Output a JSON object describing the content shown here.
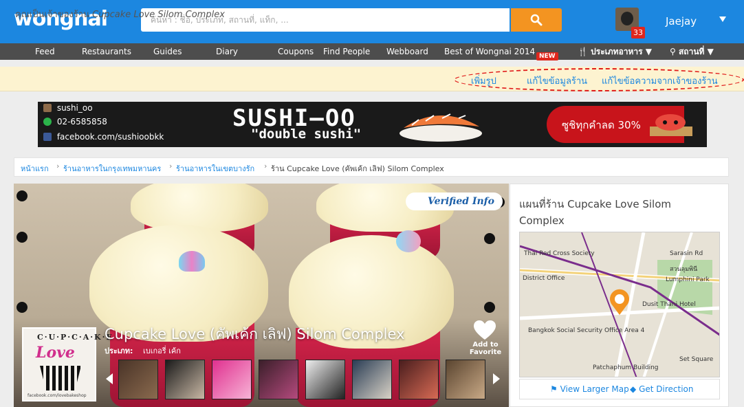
{
  "header": {
    "logo_text": "wongnai",
    "search_placeholder": "ค้นหา : ชื่อ, ประเภท, สถานที่, แท็ก, ...",
    "notification_count": "33",
    "username": "Jaejay"
  },
  "nav": {
    "items": [
      "Feed",
      "Restaurants",
      "Guides",
      "Diary",
      "Coupons",
      "Find People",
      "Webboard",
      "Best of Wongnai 2014"
    ],
    "new_badge": "NEW",
    "food_type": "ประเภทอาหาร",
    "location": "สถานที่"
  },
  "owner_bar": {
    "prefix": "คุณเป็นเจ้าของร้าน",
    "shop": "Cupcake Love Silom Complex",
    "links": [
      "เพิ่มรูป",
      "แก้ไขข้อมูลร้าน",
      "แก้ไขข้อความจากเจ้าของร้าน"
    ]
  },
  "ad": {
    "handle": "sushi_oo",
    "phone": "02-6585858",
    "facebook": "facebook.com/sushioobkk",
    "title": "SUSHI—OO",
    "subtitle": "\"double sushi\"",
    "promo": "ซูชิทุกคำลด 30%"
  },
  "breadcrumb": {
    "items": [
      "หน้าแรก",
      "ร้านอาหารในกรุงเทพมหานคร",
      "ร้านอาหารในเขตบางรัก"
    ],
    "current": "ร้าน Cupcake Love (คัพเค้ก เลิฟ) Silom Complex"
  },
  "shop": {
    "verified": "Verified Info",
    "name": "Cupcake Love (คัพเค้ก เลิฟ) Silom Complex",
    "type_label": "ประเภท:",
    "type_value": "เบเกอรี่ เค้ก",
    "favorite": "Add to Favorite",
    "logo_brand": "C·U·P·C·A·K·E",
    "logo_script": "Love",
    "logo_url": "facebook.com/lovebakeshop"
  },
  "map": {
    "title": "แผนที่ร้าน Cupcake Love Silom Complex",
    "view_larger": "View Larger Map",
    "get_direction": "Get Direction",
    "labels": [
      "Thai Red Cross Society",
      "Sarasin Rd",
      "District Office",
      "Lumphini Park",
      "Dusit Thani Hotel",
      "Bangkok Social Security Office Area 4",
      "Set Square",
      "Patchaphum Building",
      "สวนลุมพินี"
    ]
  },
  "colors": {
    "header_blue": "#1c87e0",
    "search_orange": "#f39421",
    "nav_gray": "#4d4d4d",
    "owner_bg": "#fdf3d0",
    "link_blue": "#1c87e0",
    "annotation_red": "#e01818"
  }
}
